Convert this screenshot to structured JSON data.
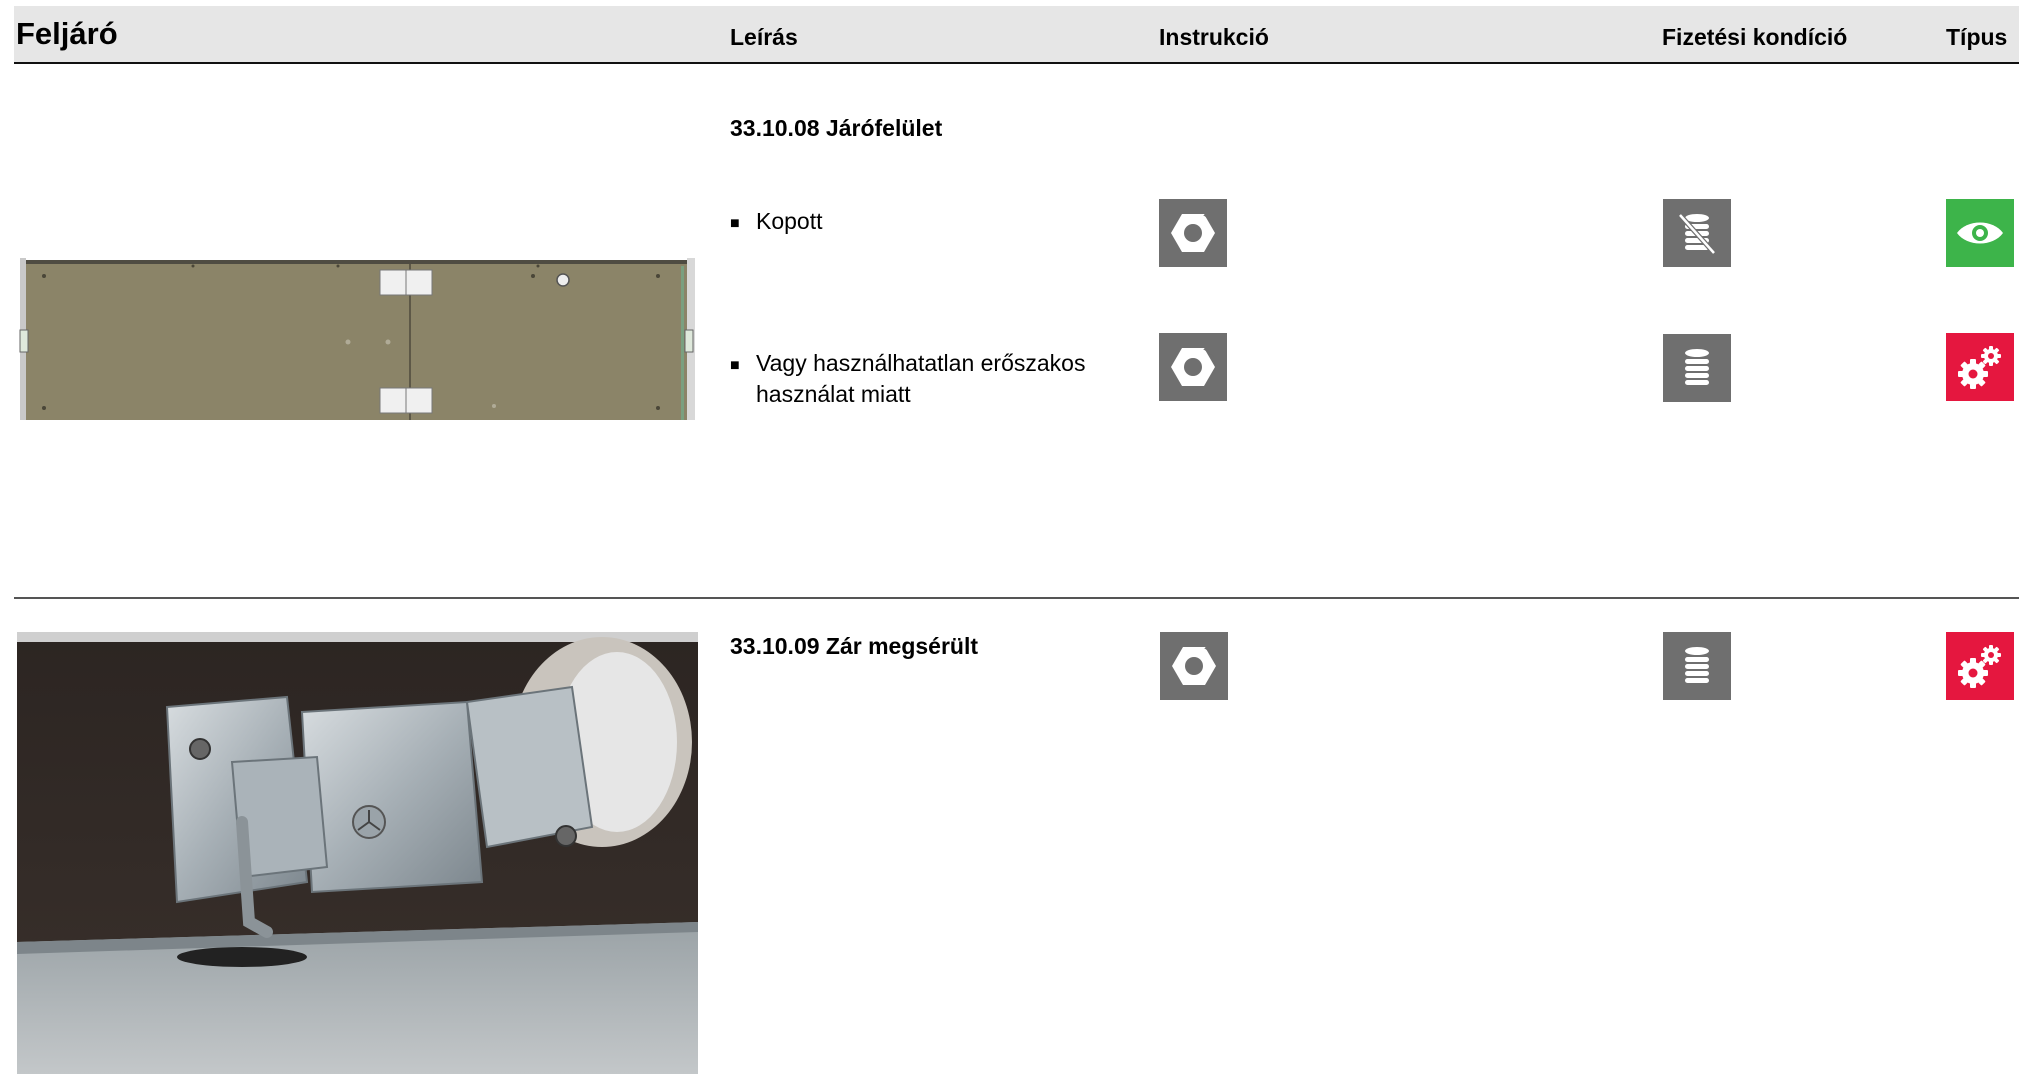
{
  "header": {
    "title": "Feljáró",
    "columns": {
      "description": "Leírás",
      "instruction": "Instrukció",
      "payment": "Fizetési kondíció",
      "type": "Típus"
    }
  },
  "sections": [
    {
      "title": "33.10.08 Járófelület",
      "items": [
        {
          "bullet": "■",
          "text_line1": "Kopott",
          "text_line2": "",
          "instruction_icon": "nut-icon",
          "payment_icon": "coin-stack-crossed-icon",
          "type_icon": "eye-icon",
          "type_color": "#3db44a"
        },
        {
          "bullet": "■",
          "text_line1": "Vagy használhatatlan erőszakos",
          "text_line2": "használat miatt",
          "instruction_icon": "nut-icon",
          "payment_icon": "coin-stack-icon",
          "type_icon": "gears-icon",
          "type_color": "#e5173f"
        }
      ]
    },
    {
      "title": "33.10.09 Zár megsérült",
      "items": [
        {
          "instruction_icon": "nut-icon",
          "payment_icon": "coin-stack-icon",
          "type_icon": "gears-icon",
          "type_color": "#e5173f"
        }
      ]
    }
  ],
  "colors": {
    "icon_gray": "#6f6f6f",
    "eye_green": "#3db44a",
    "gears_red": "#e5173f",
    "header_bg": "#e6e6e6"
  }
}
